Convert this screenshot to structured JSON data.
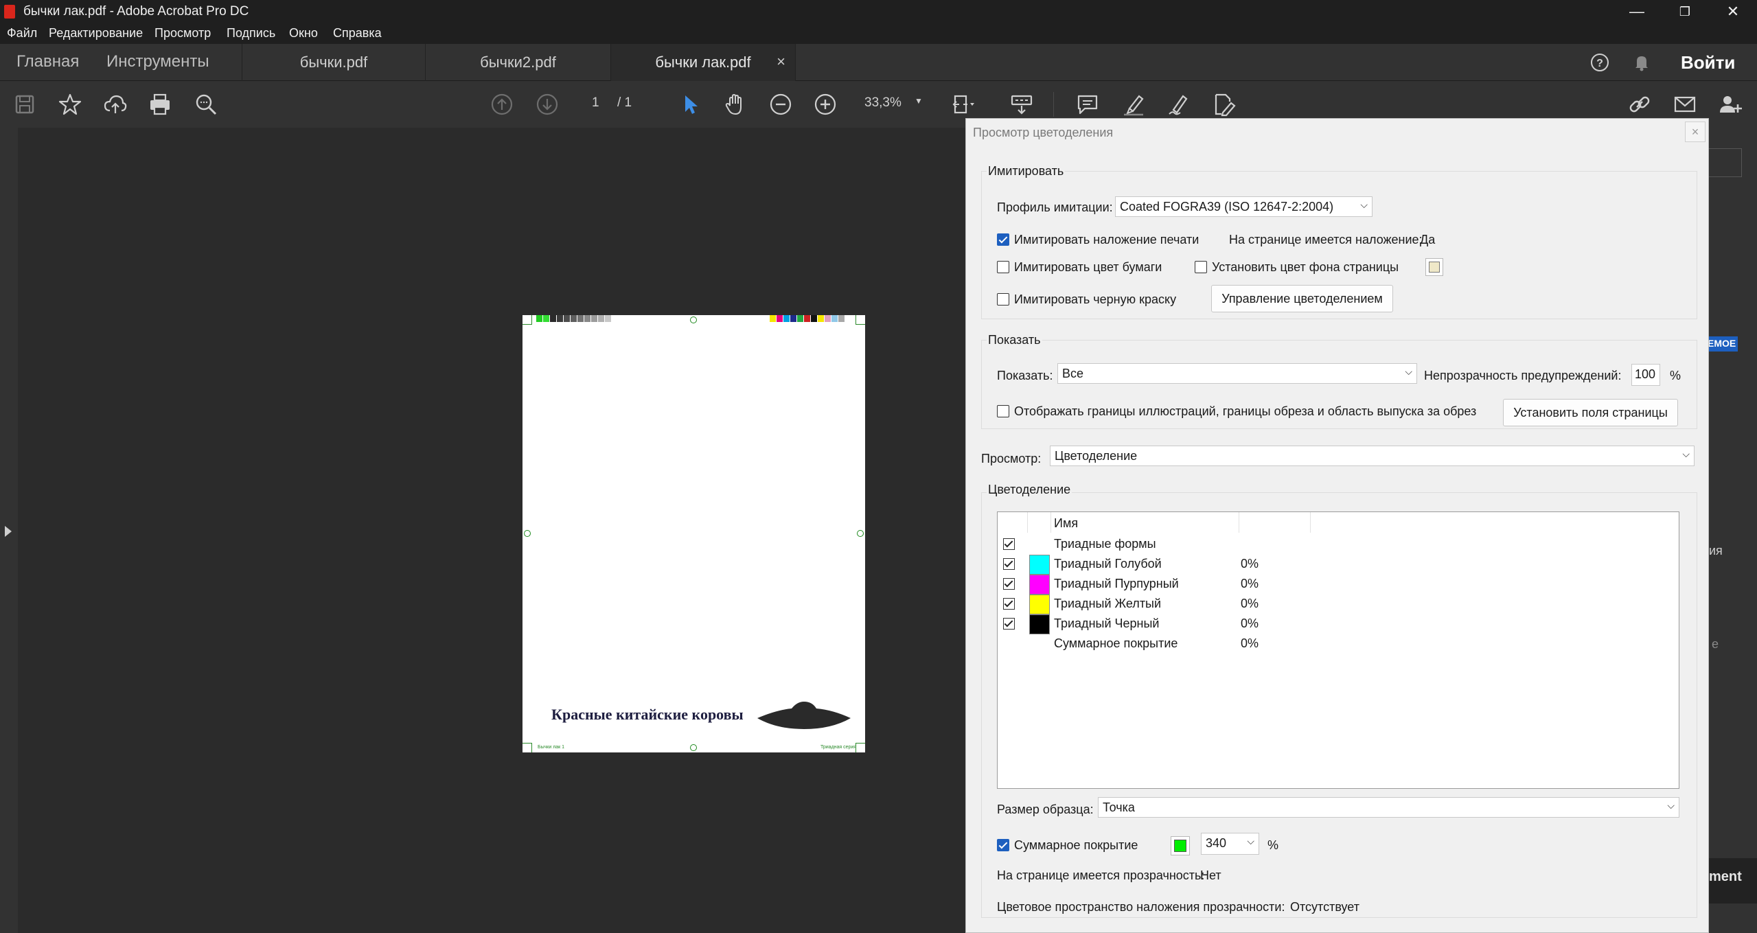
{
  "window": {
    "title": "бычки лак.pdf - Adobe Acrobat Pro DC",
    "controls": {
      "minimize": "—",
      "restore": "❐",
      "close": "✕"
    }
  },
  "menu": [
    "Файл",
    "Редактирование",
    "Просмотр",
    "Подпись",
    "Окно",
    "Справка"
  ],
  "nav": {
    "home": "Главная",
    "tools": "Инструменты"
  },
  "tabs": [
    {
      "label": "бычки.pdf",
      "active": false
    },
    {
      "label": "бычки2.pdf",
      "active": false
    },
    {
      "label": "бычки лак.pdf",
      "active": true,
      "close": "×"
    }
  ],
  "account": {
    "signin_label": "Войти",
    "help_icon": "help-icon",
    "bell_icon": "bell-icon"
  },
  "toolbar": {
    "page_current": "1",
    "page_total": "/ 1",
    "zoom": "33,3%",
    "icons": [
      "save-icon",
      "star-icon",
      "cloud-upload-icon",
      "print-icon",
      "search-icon",
      "prev-page-icon",
      "next-page-icon",
      "select-arrow-icon",
      "hand-icon",
      "zoom-out-icon",
      "zoom-in-icon",
      "fit-page-icon",
      "scroll-mode-icon",
      "comment-icon",
      "highlight-icon",
      "sign-icon",
      "edit-pdf-icon",
      "share-link-icon",
      "email-icon",
      "add-user-icon"
    ]
  },
  "pdf_page": {
    "heading": "Красные китайские коровы",
    "footer_left": "Бычки лак 1",
    "footer_right": "Триадная серия",
    "colorbar_left": [
      "#22cc22",
      "#33dd33",
      "#2a2a2a",
      "#3a3a3a",
      "#4d4d4d",
      "#5f5f5f",
      "#737373",
      "#888888",
      "#9c9c9c",
      "#b0b0b0",
      "#c8c8c8"
    ],
    "colorbar_right": [
      "#f5e600",
      "#e6007e",
      "#00a0e3",
      "#1d2b8c",
      "#22aa44",
      "#cc2222",
      "#111111",
      "#f5e600",
      "#e0a0c0",
      "#90c8e8",
      "#a8a8a8"
    ]
  },
  "dialog": {
    "title": "Просмотр цветоделения",
    "close": "×",
    "simulate": {
      "group_label": "Имитировать",
      "profile_label": "Профиль имитации:",
      "profile_value": "Coated FOGRA39 (ISO 12647-2:2004)",
      "overprint_label": "Имитировать наложение печати",
      "overprint_checked": true,
      "has_overprint_label": "На странице имеется наложение:",
      "has_overprint_value": "Да",
      "paper_color_label": "Имитировать цвет бумаги",
      "paper_color_checked": false,
      "bg_color_label": "Установить цвет фона страницы",
      "bg_color_checked": false,
      "bg_swatch": "#efe8c8",
      "black_ink_label": "Имитировать черную краску",
      "black_ink_checked": false,
      "manage_button": "Управление цветоделением"
    },
    "show": {
      "group_label": "Показать",
      "show_label": "Показать:",
      "show_value": "Все",
      "opacity_label": "Непрозрачность предупреждений:",
      "opacity_value": "100",
      "opacity_unit": "%",
      "art_bounds_label": "Отображать границы иллюстраций, границы обреза и область выпуска за обрез",
      "art_bounds_checked": false,
      "page_boxes_button": "Установить поля страницы"
    },
    "preview_label": "Просмотр:",
    "preview_value": "Цветоделение",
    "separations": {
      "group_label": "Цветоделение",
      "column_name": "Имя",
      "rows": [
        {
          "name": "Триадные формы",
          "value": "",
          "checked": true,
          "color": ""
        },
        {
          "name": "Триадный Голубой",
          "value": "0%",
          "checked": true,
          "color": "#00ffff"
        },
        {
          "name": "Триадный Пурпурный",
          "value": "0%",
          "checked": true,
          "color": "#ff00ff"
        },
        {
          "name": "Триадный Желтый",
          "value": "0%",
          "checked": true,
          "color": "#ffff00"
        },
        {
          "name": "Триадный Черный",
          "value": "0%",
          "checked": true,
          "color": "#000000"
        },
        {
          "name": "Суммарное покрытие",
          "value": "0%",
          "checked": false,
          "color": ""
        }
      ]
    },
    "sample_size_label": "Размер образца:",
    "sample_size_value": "Точка",
    "total_coverage_label": "Суммарное покрытие",
    "total_coverage_checked": true,
    "total_coverage_color": "#00ee00",
    "total_coverage_value": "340",
    "total_coverage_unit": "%",
    "transparency_label": "На странице имеется прозрачность:",
    "transparency_value": "Нет",
    "blend_space_label": "Цветовое пространство наложения прозрачности:",
    "blend_space_value": "Отсутствует"
  },
  "behind_dialog": {
    "badge": "ЕМОЕ",
    "text1": "ия",
    "text2": "е",
    "text3": "ment"
  }
}
